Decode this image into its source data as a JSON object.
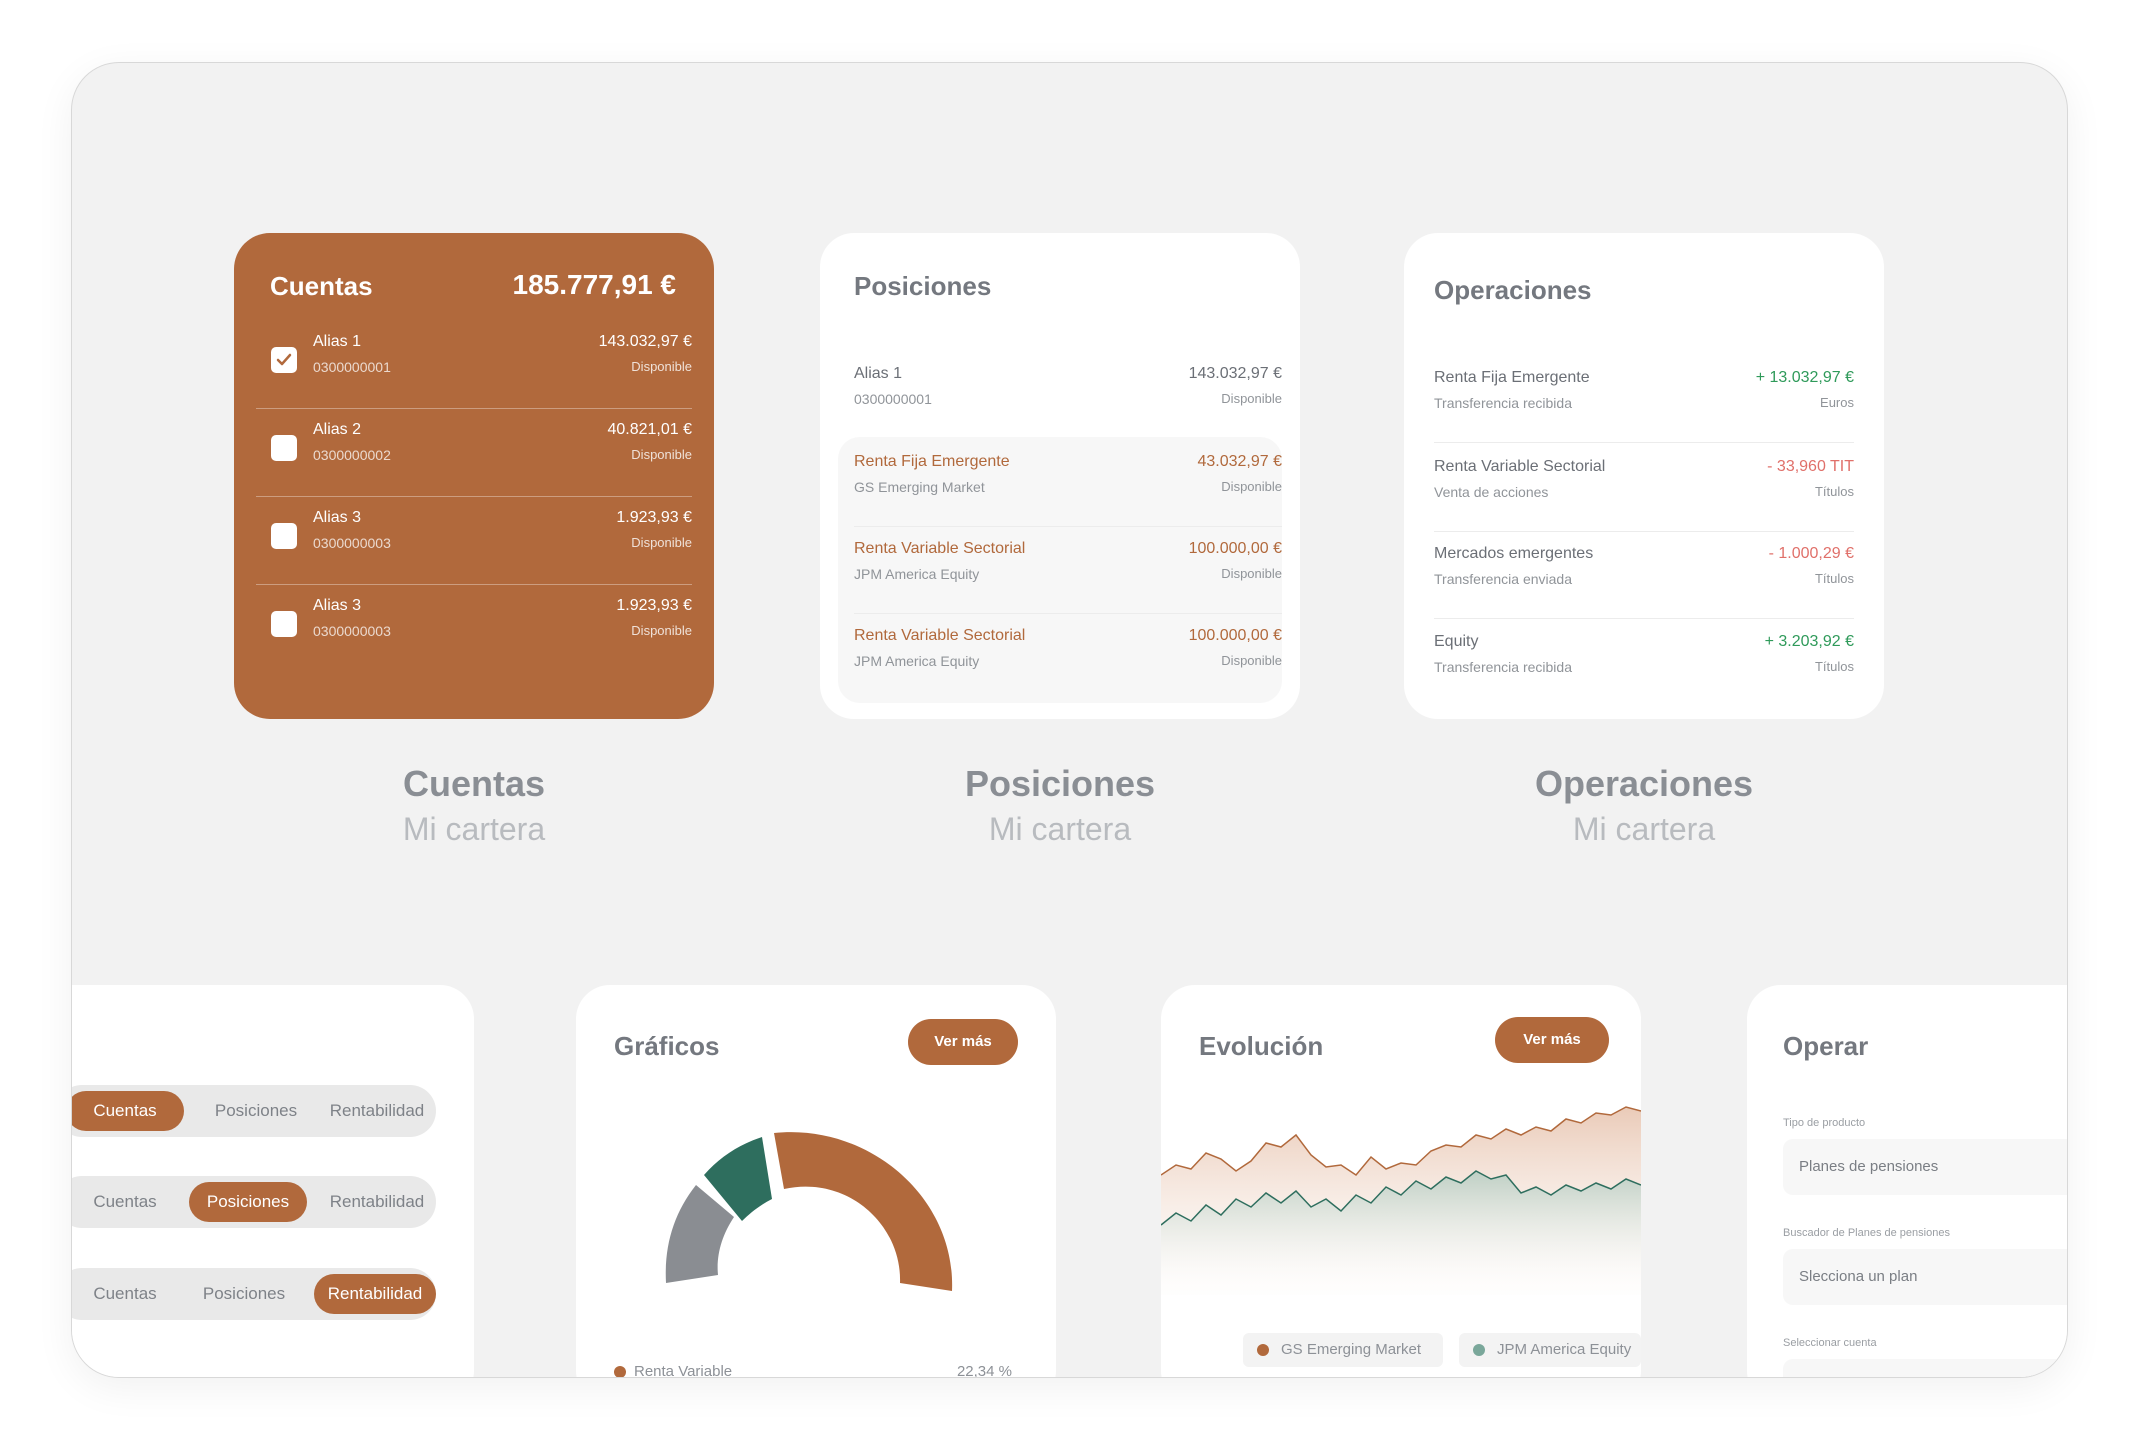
{
  "cuentas": {
    "title": "Cuentas",
    "total": "185.777,91 €",
    "rows": [
      {
        "name": "Alias 1",
        "number": "0300000001",
        "amount": "143.032,97 €",
        "status": "Disponible",
        "checked": true
      },
      {
        "name": "Alias 2",
        "number": "0300000002",
        "amount": "40.821,01 €",
        "status": "Disponible",
        "checked": false
      },
      {
        "name": "Alias 3",
        "number": "0300000003",
        "amount": "1.923,93 €",
        "status": "Disponible",
        "checked": false
      },
      {
        "name": "Alias 3",
        "number": "0300000003",
        "amount": "1.923,93 €",
        "status": "Disponible",
        "checked": false
      }
    ],
    "check_icon": "check-icon"
  },
  "posiciones": {
    "title": "Posiciones",
    "rows": [
      {
        "name": "Alias 1",
        "sub": "0300000001",
        "amount": "143.032,97 €",
        "status": "Disponible"
      },
      {
        "name": "Renta Fija Emergente",
        "sub": "GS Emerging Market",
        "amount": "43.032,97 €",
        "status": "Disponible"
      },
      {
        "name": "Renta Variable Sectorial",
        "sub": "JPM America Equity",
        "amount": "100.000,00 €",
        "status": "Disponible"
      },
      {
        "name": "Renta Variable Sectorial",
        "sub": "JPM America Equity",
        "amount": "100.000,00 €",
        "status": "Disponible"
      }
    ]
  },
  "operaciones": {
    "title": "Operaciones",
    "rows": [
      {
        "name": "Renta Fija Emergente",
        "sub": "Transferencia recibida",
        "amount": "+ 13.032,97 €",
        "unit": "Euros",
        "sign": "positive"
      },
      {
        "name": "Renta Variable Sectorial",
        "sub": "Venta de acciones",
        "amount": "- 33,960 TIT",
        "unit": "Títulos",
        "sign": "negative"
      },
      {
        "name": "Mercados emergentes",
        "sub": "Transferencia enviada",
        "amount": "- 1.000,29 €",
        "unit": "Títulos",
        "sign": "negative"
      },
      {
        "name": "Equity",
        "sub": "Transferencia recibida",
        "amount": "+ 3.203,92 €",
        "unit": "Títulos",
        "sign": "positive"
      }
    ]
  },
  "captions": [
    {
      "title": "Cuentas",
      "subtitle": "Mi cartera"
    },
    {
      "title": "Posiciones",
      "subtitle": "Mi cartera"
    },
    {
      "title": "Operaciones",
      "subtitle": "Mi cartera"
    }
  ],
  "segments": {
    "options": [
      "Cuentas",
      "Posiciones",
      "Rentabilidad"
    ],
    "rows": [
      {
        "active": "Cuentas"
      },
      {
        "active": "Posiciones"
      },
      {
        "active": "Rentabilidad"
      }
    ]
  },
  "graficos": {
    "title": "Gráficos",
    "button": "Ver más",
    "legend_label": "Renta Variable",
    "legend_value": "22,34 %",
    "colors": {
      "gray": "#8a8d92",
      "green": "#2e6e5e",
      "orange": "#b1693c"
    }
  },
  "evolucion": {
    "title": "Evolución",
    "button": "Ver más",
    "legend": [
      {
        "name": "GS Emerging Market",
        "color": "#b1693c"
      },
      {
        "name": "JPM America Equity",
        "color": "#7aa79a"
      }
    ]
  },
  "operar": {
    "title": "Operar",
    "fields": [
      {
        "label": "Tipo de producto",
        "value": "Planes de pensiones"
      },
      {
        "label": "Buscador de Planes de pensiones",
        "value": "Slecciona un plan"
      },
      {
        "label": "Seleccionar cuenta",
        "value": ""
      }
    ]
  },
  "colors": {
    "accent": "#b1693c",
    "positive": "#2f9a5a",
    "negative": "#e0706a",
    "background": "#f2f2f2"
  }
}
